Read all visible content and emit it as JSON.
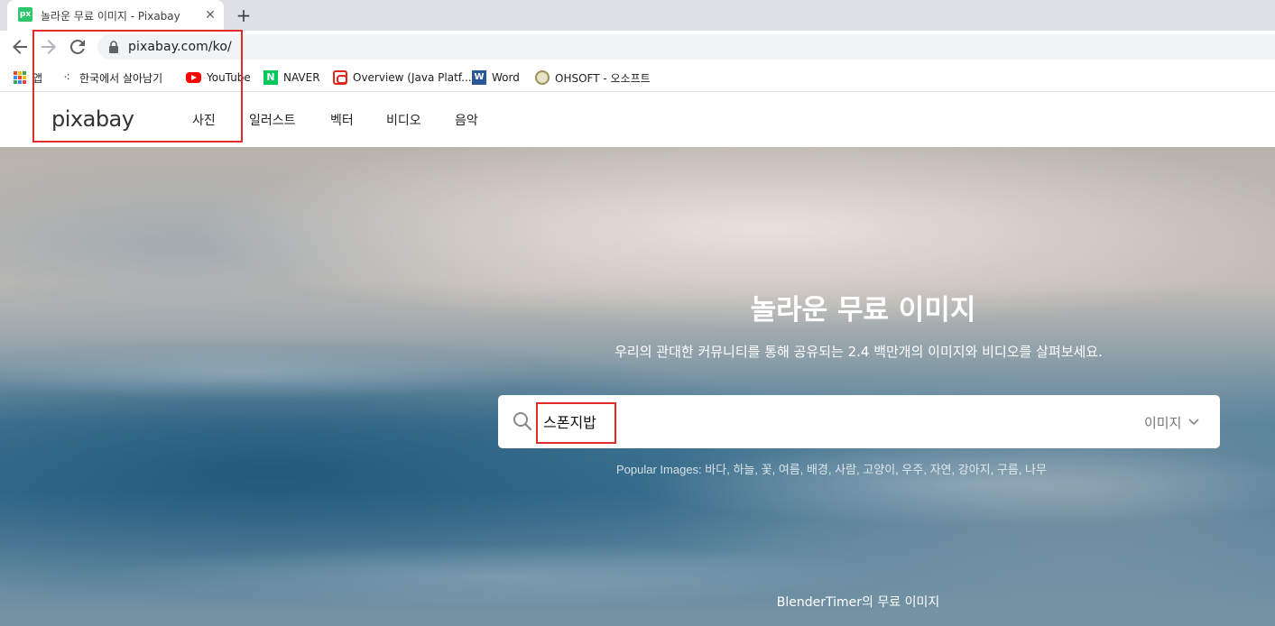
{
  "browser": {
    "tab": {
      "favicon": "px",
      "title": "놀라운 무료 이미지 - Pixabay",
      "close": "✕"
    },
    "new_tab": "+",
    "url": "pixabay.com/ko/",
    "bookmarks": [
      {
        "label": "앱",
        "icon": "apps-grid-icon"
      },
      {
        "label": "한국에서 살아남기",
        "icon": "dots-icon"
      },
      {
        "label": "YouTube",
        "icon": "youtube-icon"
      },
      {
        "label": "NAVER",
        "icon": "naver-icon",
        "glyph": "N"
      },
      {
        "label": "Overview (Java Platf...",
        "icon": "oracle-icon"
      },
      {
        "label": "Word",
        "icon": "word-icon",
        "glyph": "W"
      },
      {
        "label": "OHSOFT - 오소프트",
        "icon": "ohsoft-icon"
      }
    ]
  },
  "site": {
    "logo": "pixabay",
    "nav": [
      "사진",
      "일러스트",
      "벡터",
      "비디오",
      "음악"
    ]
  },
  "hero": {
    "title": "놀라운 무료 이미지",
    "subtitle": "우리의 관대한 커뮤니티를 통해 공유되는 2.4 백만개의 이미지와 비디오를 살펴보세요.",
    "search_value": "스폰지밥",
    "search_type": "이미지",
    "popular_label": "Popular Images:",
    "popular_tags": [
      "바다",
      "하늘",
      "꽃",
      "여름",
      "배경",
      "사람",
      "고양이",
      "우주",
      "자연",
      "강아지",
      "구름",
      "나무"
    ],
    "credit": "BlenderTimer의 무료 이미지"
  },
  "colors": {
    "annotation": "#e02b2b",
    "chrome_tab_strip": "#dee1e6",
    "omnibox": "#f1f3f4"
  }
}
